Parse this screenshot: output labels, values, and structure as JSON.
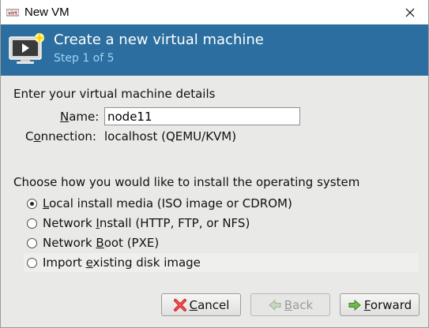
{
  "window": {
    "title": "New VM"
  },
  "header": {
    "title": "Create a new virtual machine",
    "step": "Step 1 of 5"
  },
  "details": {
    "heading": "Enter your virtual machine details",
    "name_label_u": "N",
    "name_label_rest": "ame:",
    "name_value": "node11",
    "connection_label_pre": "C",
    "connection_label_u": "o",
    "connection_label_rest": "nnection:",
    "connection_value": "localhost (QEMU/KVM)"
  },
  "install": {
    "heading": "Choose how you would like to install the operating system",
    "selected_index": 0,
    "options": [
      {
        "pre": "",
        "u": "L",
        "rest": "ocal install media (ISO image or CDROM)"
      },
      {
        "pre": "Network ",
        "u": "I",
        "rest": "nstall (HTTP, FTP, or NFS)"
      },
      {
        "pre": "Network ",
        "u": "B",
        "rest": "oot (PXE)"
      },
      {
        "pre": "Import ",
        "u": "e",
        "rest": "xisting disk image"
      }
    ]
  },
  "buttons": {
    "cancel": {
      "u": "C",
      "rest": "ancel"
    },
    "back": {
      "u": "B",
      "rest": "ack"
    },
    "forward": {
      "u": "F",
      "rest": "orward"
    }
  },
  "colors": {
    "banner": "#2b6e9f",
    "banner_subtitle": "#9ed3f7",
    "dialog_bg": "#e9e9e7"
  },
  "icons": {
    "app": "virt-manager-icon",
    "banner": "new-vm-monitor-icon",
    "close": "close-icon",
    "cancel": "red-x-icon",
    "back": "back-arrow-icon",
    "forward": "forward-arrow-icon"
  }
}
